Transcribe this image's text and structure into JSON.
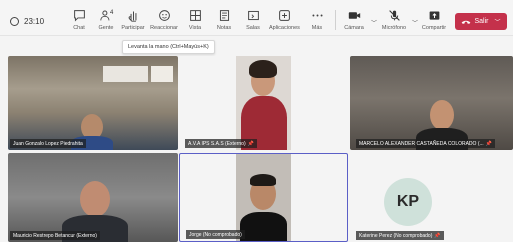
{
  "call": {
    "elapsed": "23:10"
  },
  "toolbar": {
    "chat": "Chat",
    "people": "Gente",
    "people_count": "4",
    "raise_hand": "Participar",
    "react": "Reaccionar",
    "view": "Vista",
    "notes": "Notas",
    "rooms": "Salas",
    "apps": "Aplicaciones",
    "more": "Más",
    "camera": "Cámara",
    "mic": "Micrófono",
    "share": "Compartir",
    "leave": "Salir"
  },
  "tooltip": "Levanta la mano (Ctrl+Mayús+K)",
  "tiles": [
    {
      "name": "Juan Gonzalo Lopez Piedrahita"
    },
    {
      "name": "A.V.A IPS S.A.S (Externo)"
    },
    {
      "name": "MARCELO ALEXANDER CASTAÑEDA COLORADO (..."
    },
    {
      "name": "Mauricio Restrepo Betancur (Externo)"
    },
    {
      "name": "Jorge (No comprobado)"
    },
    {
      "name": "Katerine Perez (No comprobado)",
      "initials": "KP"
    }
  ],
  "colors": {
    "leave": "#c4314b",
    "active_border": "#5b5fc7",
    "avatar_bg": "#cfe1da"
  }
}
